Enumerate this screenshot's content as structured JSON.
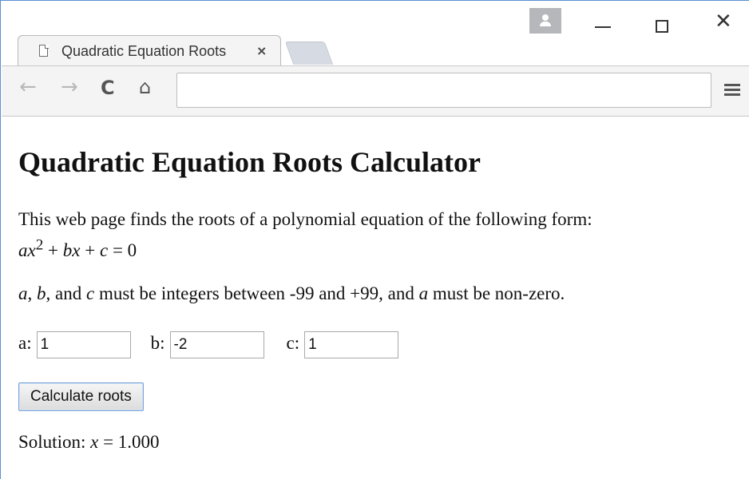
{
  "browser": {
    "tab_title": "Quadratic Equation Roots",
    "tab_close": "×",
    "address_value": ""
  },
  "page": {
    "title": "Quadratic Equation Roots Calculator",
    "intro_text": "This web page finds the roots of a polynomial equation of the following form:",
    "equation": {
      "a": "ax",
      "exp": "2",
      "plus1": " + ",
      "b": "bx",
      "plus2": " + ",
      "c": "c",
      "equals": " = 0"
    },
    "constraint": {
      "a": "a",
      "sep1": ", ",
      "b": "b",
      "sep2": ", and ",
      "c": "c",
      "mid": " must be integers between -99 and +99, and ",
      "a2": "a",
      "end": " must be non-zero."
    },
    "fields": {
      "a_label": "a:",
      "a_value": "1",
      "b_label": "b:",
      "b_value": "-2",
      "c_label": "c:",
      "c_value": "1"
    },
    "button_label": "Calculate roots",
    "solution": {
      "prefix": "Solution: ",
      "var": "x",
      "value": " = 1.000"
    }
  }
}
